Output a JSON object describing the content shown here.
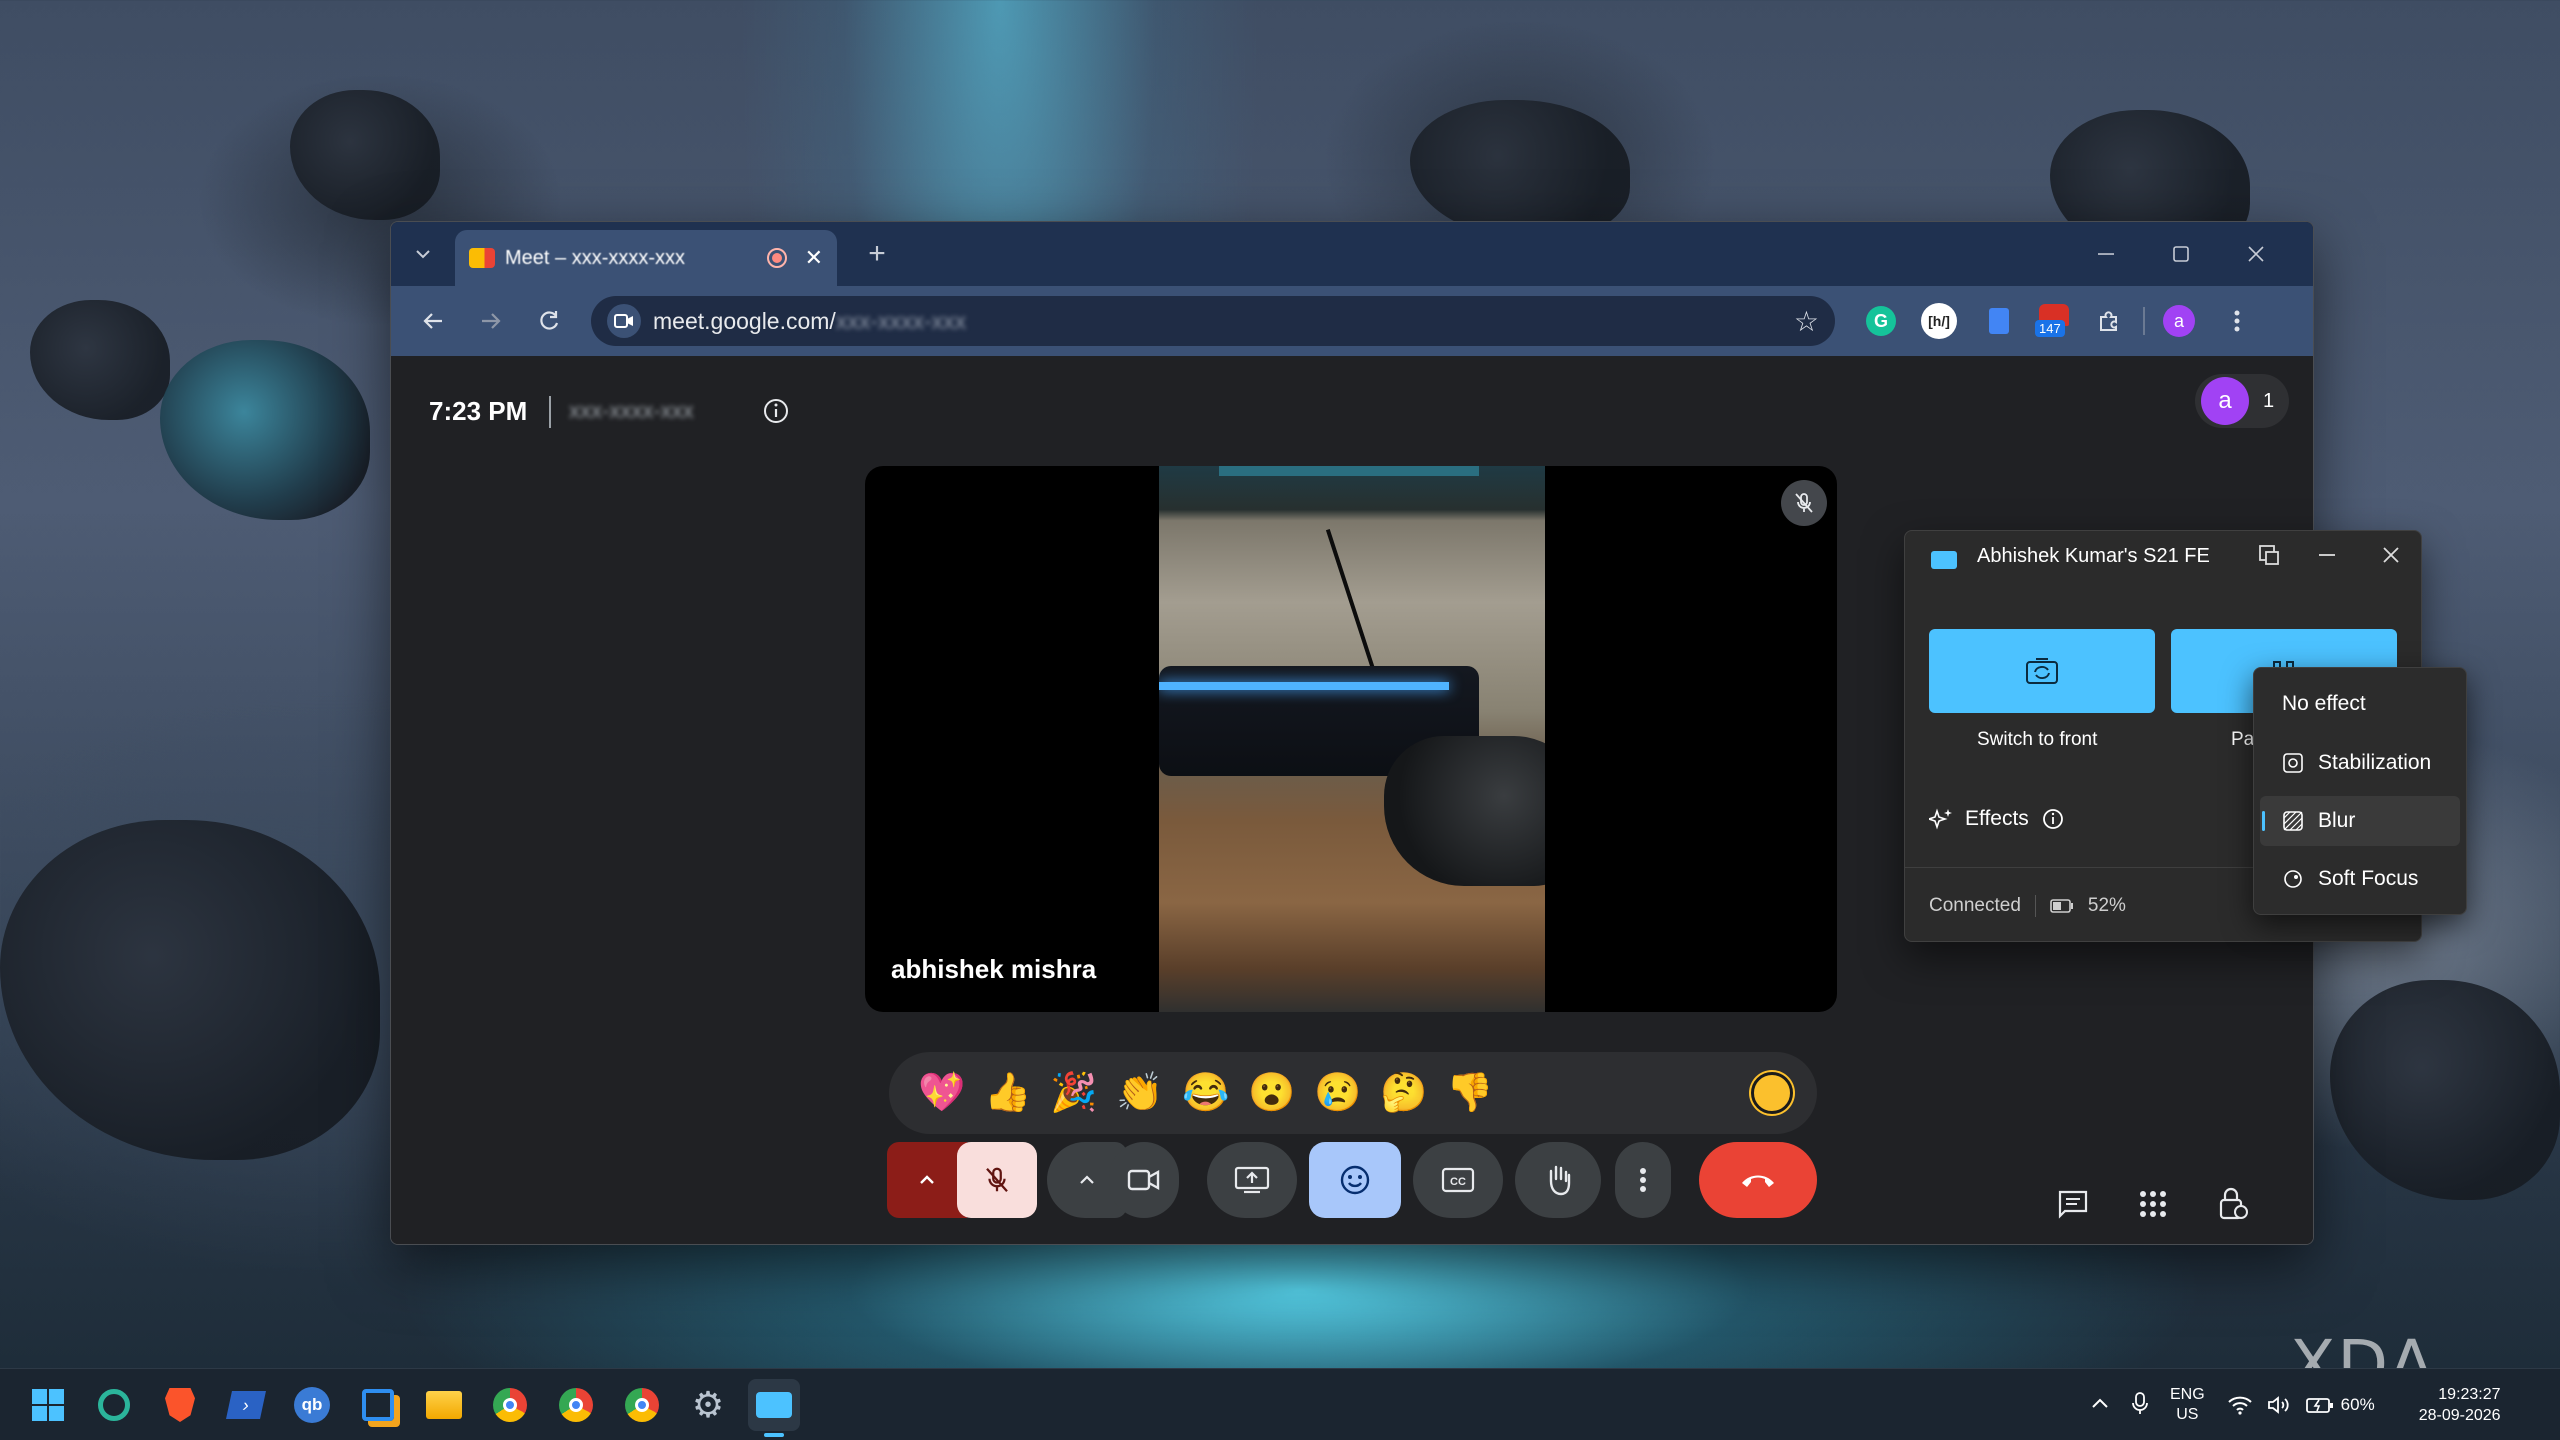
{
  "browser": {
    "tab_title": "Meet – xxx-xxxx-xxx",
    "url": "meet.google.com/",
    "url_suffix": "xxx-xxxx-xxx",
    "extension_badge": "147",
    "profile_initial": "a"
  },
  "meet": {
    "time": "7:23 PM",
    "meeting_code": "xxx-xxxx-xxx",
    "participant_name": "abhishek mishra",
    "participant_count": "1",
    "avatar_initial": "a",
    "reactions": [
      "💖",
      "👍",
      "🎉",
      "👏",
      "😂",
      "😮",
      "😢",
      "🤔",
      "👎"
    ],
    "colors": {
      "end_call": "#ea4335",
      "mic_muted_bg": "#f9dedc",
      "mic_chevron_bg": "#8c1d18",
      "emoji_active": "#a8c7fa",
      "skin_tone": "#fbc02d"
    }
  },
  "phone_link": {
    "title": "Abhishek Kumar's S21 FE",
    "switch_label": "Switch to front",
    "pause_label": "Pa",
    "effects_label": "Effects",
    "status": "Connected",
    "battery": "52%",
    "menu": [
      "No effect",
      "Stabilization",
      "Blur",
      "Soft Focus"
    ],
    "selected_menu": "Blur",
    "accent": "#4cc2ff"
  },
  "taskbar": {
    "lang_top": "ENG",
    "lang_bottom": "US",
    "battery": "60%",
    "time": "19:23:27",
    "date": "28-09-2026"
  },
  "watermark": "XDA"
}
